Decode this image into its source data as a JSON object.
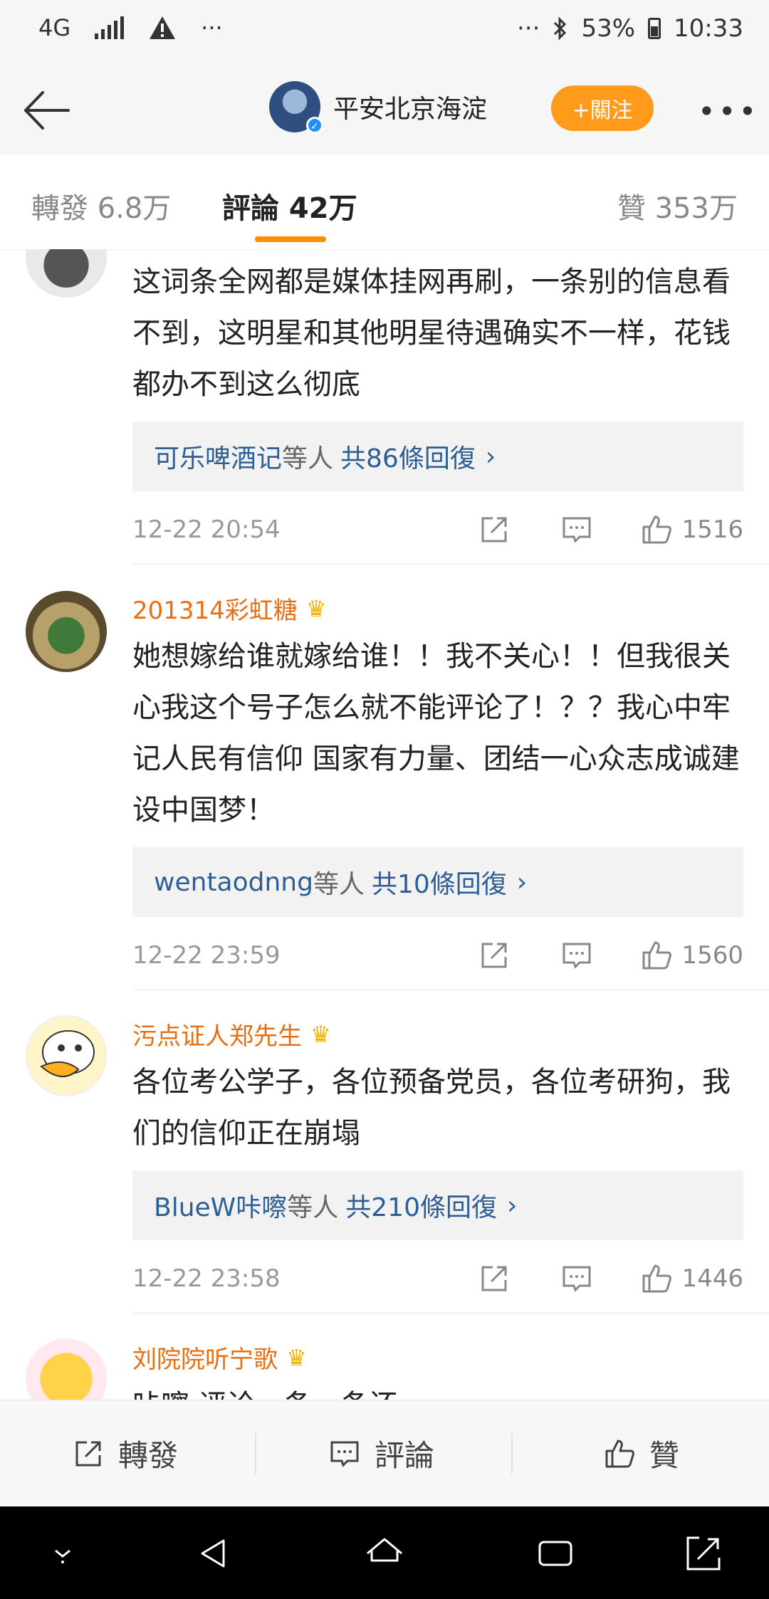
{
  "status_bar": {
    "network": "4G",
    "dots_left": "···",
    "dots_right": "···",
    "battery": "53%",
    "time": "10:33"
  },
  "header": {
    "account_name": "平安北京海淀",
    "follow_label": "+關注"
  },
  "tabs": [
    {
      "label": "轉發 6.8万"
    },
    {
      "label": "評論 42万"
    },
    {
      "label": "贊 353万"
    }
  ],
  "comments": [
    {
      "user": "",
      "text": "这词条全网都是媒体挂网再刷，一条别的信息看不到，这明星和其他明星待遇确实不一样，花钱都办不到这么彻底",
      "reply_users": "可乐啤酒记",
      "reply_mid": "等人",
      "reply_count": "共86條回復",
      "time": "12-22 20:54",
      "likes": "1516"
    },
    {
      "user": "201314彩虹糖",
      "text": "她想嫁给谁就嫁给谁！！我不关心！！但我很关心我这个号子怎么就不能评论了！？？我心中牢记人民有信仰 国家有力量、团结一心众志成诚建设中国梦！",
      "reply_users": "wentaodnng",
      "reply_mid": "等人",
      "reply_count": "共10條回復",
      "time": "12-22 23:59",
      "likes": "1560"
    },
    {
      "user": "污点证人郑先生",
      "text": "各位考公学子，各位预备党员，各位考研狗，我们的信仰正在崩塌",
      "reply_users": "BlueW咔嚓",
      "reply_mid": "等人",
      "reply_count": "共210條回復",
      "time": "12-22 23:58",
      "likes": "1446"
    },
    {
      "user": "刘院院听宁歌",
      "text": "咔嚓 评论一条一条还"
    }
  ],
  "bottom_bar": {
    "repost": "轉發",
    "comment": "評論",
    "like": "贊"
  },
  "colors": {
    "accent": "#ff8d00",
    "username": "#e86f11",
    "link": "#2d5f96"
  }
}
